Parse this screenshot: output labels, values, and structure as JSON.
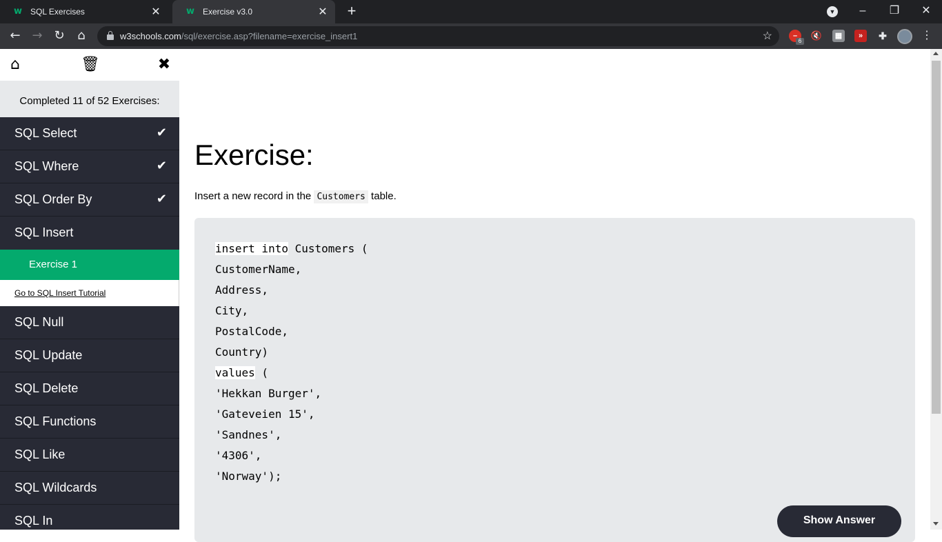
{
  "browser": {
    "tabs": [
      {
        "title": "SQL Exercises",
        "active": false
      },
      {
        "title": "Exercise v3.0",
        "active": true
      }
    ],
    "url_host": "w3schools.com",
    "url_path": "/sql/exercise.asp?filename=exercise_insert1",
    "extension_badge": "6"
  },
  "sidebar": {
    "progress_text": "Completed 11 of 52 Exercises:",
    "items": [
      {
        "label": "SQL Select",
        "completed": true
      },
      {
        "label": "SQL Where",
        "completed": true
      },
      {
        "label": "SQL Order By",
        "completed": true
      },
      {
        "label": "SQL Insert",
        "completed": false
      },
      {
        "label": "SQL Null",
        "completed": false
      },
      {
        "label": "SQL Update",
        "completed": false
      },
      {
        "label": "SQL Delete",
        "completed": false
      },
      {
        "label": "SQL Functions",
        "completed": false
      },
      {
        "label": "SQL Like",
        "completed": false
      },
      {
        "label": "SQL Wildcards",
        "completed": false
      },
      {
        "label": "SQL In",
        "completed": false
      }
    ],
    "sub_exercise": "Exercise 1",
    "tutorial_link": "Go to SQL Insert Tutorial"
  },
  "exercise": {
    "heading": "Exercise:",
    "instruction_before": "Insert a new record in the ",
    "instruction_code": "Customers",
    "instruction_after": " table.",
    "code": {
      "line1_input": "insert into",
      "line1_rest": " Customers (",
      "lines": [
        "CustomerName,",
        "Address,",
        "City,",
        "PostalCode,",
        "Country)"
      ],
      "values_input": "values",
      "values_rest": " (",
      "value_lines": [
        "'Hekkan Burger',",
        "'Gateveien 15',",
        "'Sandnes',",
        "'4306',"
      ],
      "last_line": "'Norway');"
    },
    "show_answer_label": "Show Answer"
  },
  "icons": {
    "home": "home-icon",
    "trash": "trash-icon",
    "close": "close-icon",
    "check": "check-icon"
  }
}
